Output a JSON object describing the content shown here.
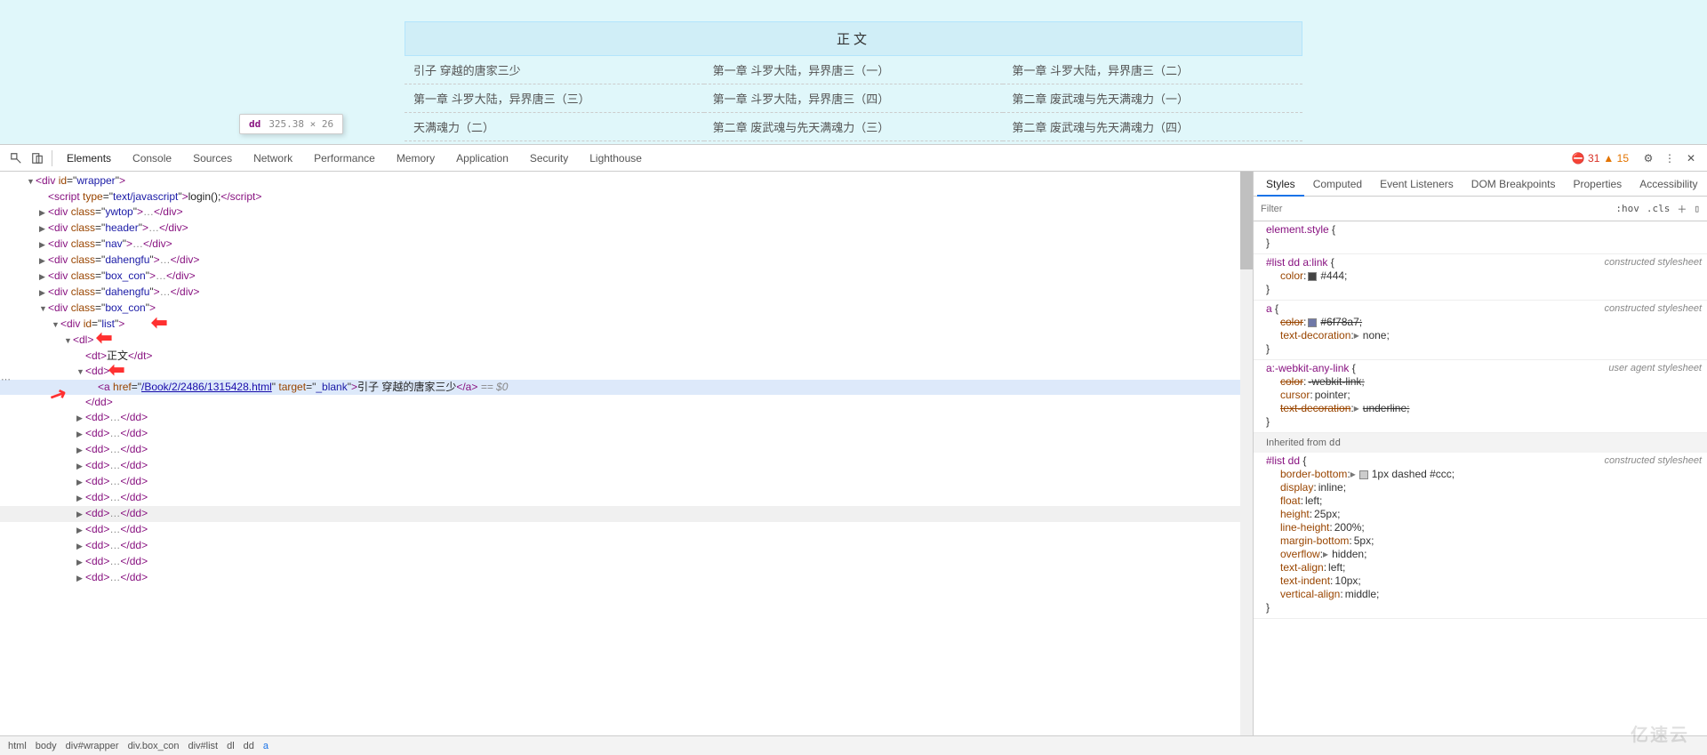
{
  "preview": {
    "header": "正文",
    "rows": [
      [
        "引子 穿越的唐家三少",
        "第一章 斗罗大陆，异界唐三（一）",
        "第一章 斗罗大陆，异界唐三（二）"
      ],
      [
        "第一章 斗罗大陆，异界唐三（三）",
        "第一章 斗罗大陆，异界唐三（四）",
        "第二章 废武魂与先天满魂力（一）"
      ],
      [
        "天满魂力（二）",
        "第二章 废武魂与先天满魂力（三）",
        "第二章 废武魂与先天满魂力（四）"
      ]
    ]
  },
  "tooltip": {
    "tag": "dd",
    "dim": "325.38 × 26"
  },
  "toolbar": {
    "tabs": [
      "Elements",
      "Console",
      "Sources",
      "Network",
      "Performance",
      "Memory",
      "Application",
      "Security",
      "Lighthouse"
    ],
    "active": "Elements",
    "errors": "31",
    "warnings": "15",
    "err_icon": "⛔",
    "warn_icon": "▲"
  },
  "dom": {
    "wrapper_id": "wrapper",
    "script_type": "text/javascript",
    "script_body": "login();",
    "classes": [
      "ywtop",
      "header",
      "nav",
      "dahengfu",
      "box_con",
      "dahengfu",
      "box_con"
    ],
    "list_id": "list",
    "dt_text": "正文",
    "dd_a_href": "/Book/2/2486/1315428.html",
    "dd_a_target": "_blank",
    "dd_a_text": "引子 穿越的唐家三少",
    "eq_label": " == $0",
    "dd_repeat_count": 11
  },
  "crumbs": [
    "html",
    "body",
    "div#wrapper",
    "div.box_con",
    "div#list",
    "dl",
    "dd",
    "a"
  ],
  "right": {
    "tabs": [
      "Styles",
      "Computed",
      "Event Listeners",
      "DOM Breakpoints",
      "Properties",
      "Accessibility"
    ],
    "active": "Styles",
    "filter_placeholder": "Filter",
    "hov": ":hov",
    "cls": ".cls"
  },
  "styles": {
    "rules": [
      {
        "sel": "element.style",
        "src": "",
        "body": []
      },
      {
        "sel": "#list dd a:link",
        "src": "constructed stylesheet",
        "body": [
          {
            "n": "color",
            "v": "#444",
            "sw": "#444"
          }
        ]
      },
      {
        "sel": "a",
        "src": "constructed stylesheet",
        "body": [
          {
            "n": "color",
            "v": "#6f78a7",
            "sw": "#6f78a7",
            "strike": true
          },
          {
            "n": "text-decoration",
            "v": "none",
            "tri": true
          }
        ]
      },
      {
        "sel": "a:-webkit-any-link",
        "src": "user agent stylesheet",
        "body": [
          {
            "n": "color",
            "v": "-webkit-link",
            "strike": true
          },
          {
            "n": "cursor",
            "v": "pointer"
          },
          {
            "n": "text-decoration",
            "v": "underline",
            "tri": true,
            "strike": true
          }
        ]
      }
    ],
    "inherited_label": "Inherited from ",
    "inherited_from": "dd",
    "inherited_rule": {
      "sel": "#list dd",
      "src": "constructed stylesheet",
      "body": [
        {
          "n": "border-bottom",
          "v": "1px dashed #ccc",
          "sw": "#ccc",
          "tri": true
        },
        {
          "n": "display",
          "v": "inline"
        },
        {
          "n": "float",
          "v": "left"
        },
        {
          "n": "height",
          "v": "25px"
        },
        {
          "n": "line-height",
          "v": "200%"
        },
        {
          "n": "margin-bottom",
          "v": "5px"
        },
        {
          "n": "overflow",
          "v": "hidden",
          "tri": true
        },
        {
          "n": "text-align",
          "v": "left"
        },
        {
          "n": "text-indent",
          "v": "10px"
        },
        {
          "n": "vertical-align",
          "v": "middle"
        }
      ]
    }
  },
  "watermark": "亿速云"
}
